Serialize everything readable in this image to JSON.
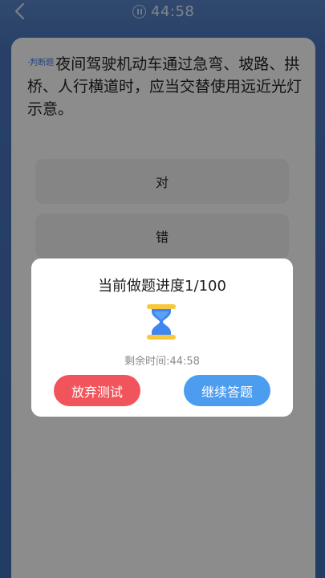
{
  "header": {
    "back_icon": "chevron-left-icon",
    "timer_icon": "pause-circle-icon",
    "timer": "44:58"
  },
  "question": {
    "type_tag": "·判断题",
    "text": "夜间驾驶机动车通过急弯、坡路、拱桥、人行横道时，应当交替使用远近光灯示意。"
  },
  "options": [
    {
      "label": "对"
    },
    {
      "label": "错"
    }
  ],
  "dialog": {
    "title": "当前做题进度1/100",
    "icon": "hourglass-icon",
    "remaining": "剩余时间:44:58",
    "quit_label": "放弃测试",
    "continue_label": "继续答题",
    "colors": {
      "quit": "#f2545b",
      "continue": "#4c9cf0",
      "hourglass_frame": "#f7c83a",
      "hourglass_sand": "#3f86f0"
    }
  }
}
